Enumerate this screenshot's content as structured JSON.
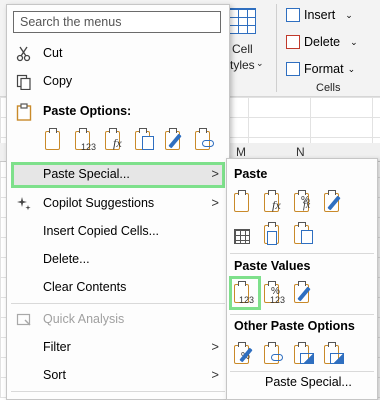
{
  "ribbon": {
    "insert": "Insert",
    "delete": "Delete",
    "format": "Format",
    "cells_group": "Cells",
    "cell_styles_line1": "Cell",
    "cell_styles_line2": "tyles",
    "col_m": "M",
    "col_n": "N"
  },
  "menu": {
    "search_placeholder": "Search the menus",
    "items": {
      "cut": "Cut",
      "copy": "Copy",
      "paste_options": "Paste Options:",
      "paste_special": "Paste Special...",
      "copilot": "Copilot Suggestions",
      "insert_copied": "Insert Copied Cells...",
      "delete": "Delete...",
      "clear": "Clear Contents",
      "quick_analysis": "Quick Analysis",
      "filter": "Filter",
      "sort": "Sort"
    }
  },
  "submenu": {
    "paste": "Paste",
    "paste_values": "Paste Values",
    "other_paste": "Other Paste Options",
    "paste_special": "Paste Special..."
  },
  "icon_tags": {
    "values_123": "123",
    "percent": "%"
  },
  "colors": {
    "highlight": "#7ee08b",
    "clipboard": "#c98a2a",
    "accent_blue": "#2f6fc0"
  }
}
